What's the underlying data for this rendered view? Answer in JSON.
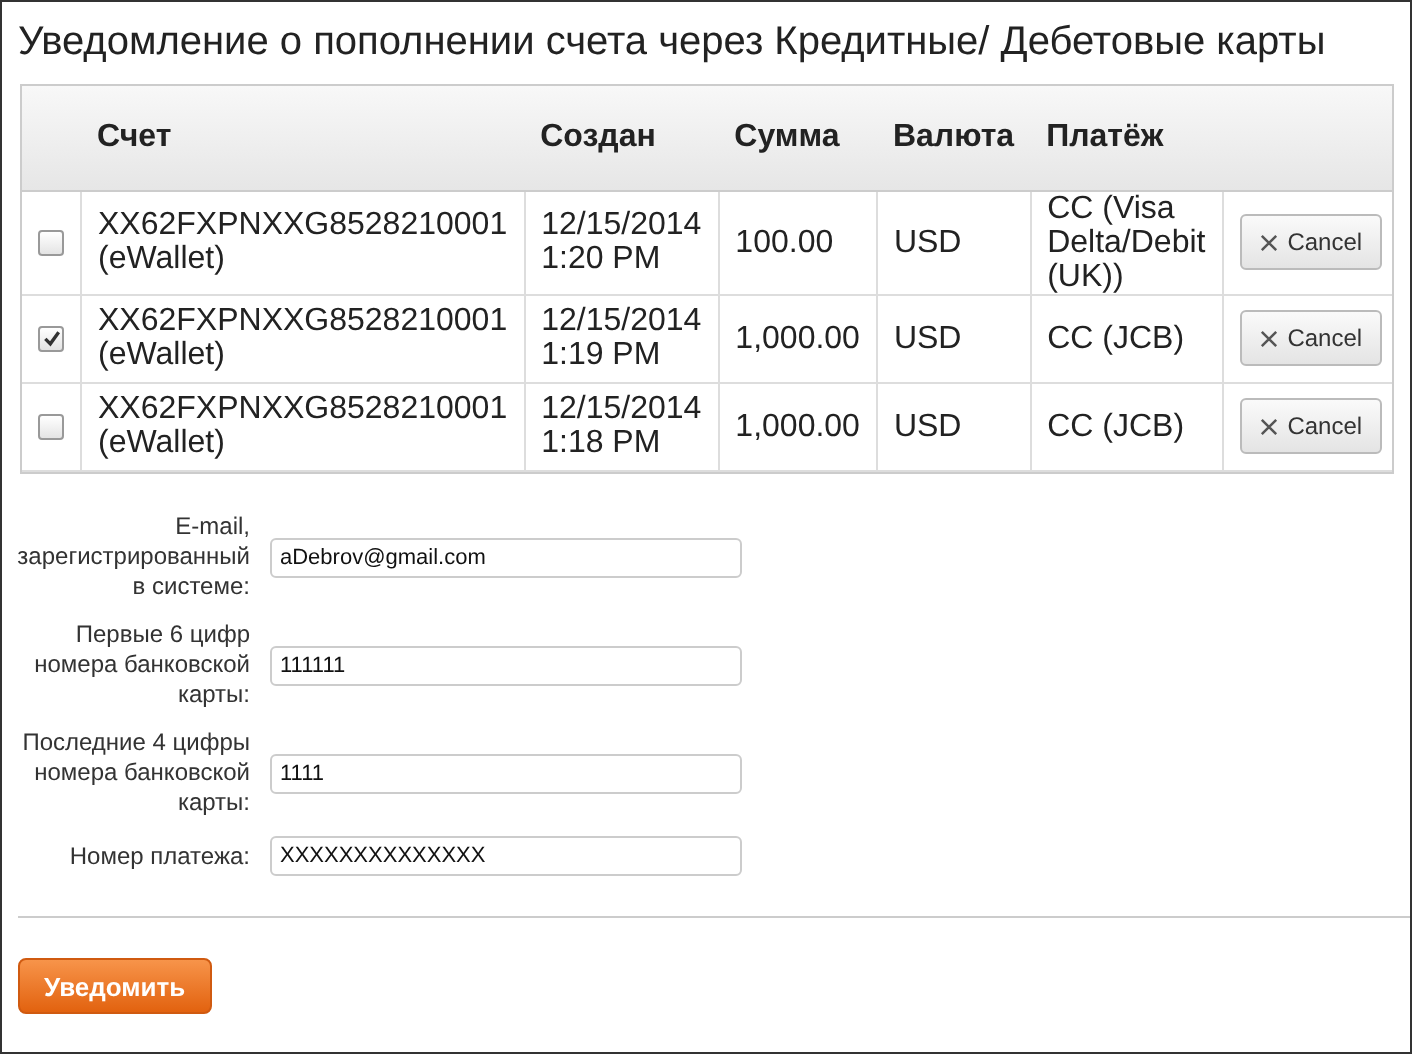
{
  "title": "Уведомление о пополнении счета через Кредитные/ Дебетовые карты",
  "table": {
    "columns": [
      "Счет",
      "Создан",
      "Сумма",
      "Валюта",
      "Платёж"
    ],
    "rows": [
      {
        "checked": false,
        "account": "XX62FXPNXXG8528210001 (eWallet)",
        "created": "12/15/2014 1:20 PM",
        "amount": "100.00",
        "currency": "USD",
        "payment": "CC (Visa Delta/Debit (UK))",
        "action": "Cancel"
      },
      {
        "checked": true,
        "account": "XX62FXPNXXG8528210001 (eWallet)",
        "created": "12/15/2014 1:19 PM",
        "amount": "1,000.00",
        "currency": "USD",
        "payment": "CC (JCB)",
        "action": "Cancel"
      },
      {
        "checked": false,
        "account": "XX62FXPNXXG8528210001 (eWallet)",
        "created": "12/15/2014 1:18 PM",
        "amount": "1,000.00",
        "currency": "USD",
        "payment": "CC (JCB)",
        "action": "Cancel"
      }
    ]
  },
  "form": [
    {
      "label": "E-mail, зарегистрированный в системе:",
      "value": "aDebrov@gmail.com"
    },
    {
      "label": "Первые 6 цифр номера банковской карты:",
      "value": "111111"
    },
    {
      "label": "Последние 4 цифры номера банковской карты:",
      "value": "1111"
    },
    {
      "label": "Номер платежа:",
      "value": "XXXXXXXXXXXXXX"
    }
  ],
  "submit": "Уведомить"
}
